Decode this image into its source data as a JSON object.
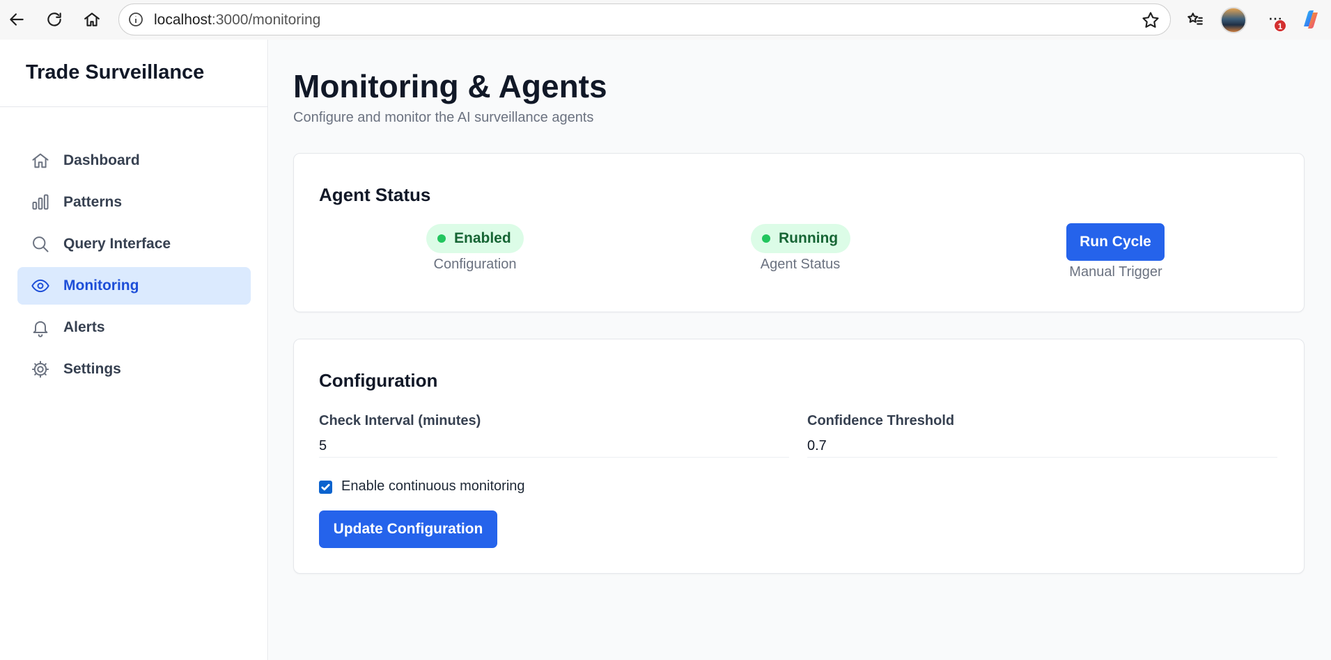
{
  "browser": {
    "url_host": "localhost",
    "url_path": ":3000/monitoring",
    "notification_count": "1"
  },
  "sidebar": {
    "brand": "Trade Surveillance",
    "items": [
      {
        "label": "Dashboard",
        "icon": "home-icon"
      },
      {
        "label": "Patterns",
        "icon": "bar-chart-icon"
      },
      {
        "label": "Query Interface",
        "icon": "search-icon"
      },
      {
        "label": "Monitoring",
        "icon": "eye-icon",
        "active": true
      },
      {
        "label": "Alerts",
        "icon": "bell-icon"
      },
      {
        "label": "Settings",
        "icon": "gear-icon"
      }
    ]
  },
  "page": {
    "title": "Monitoring & Agents",
    "subtitle": "Configure and monitor the AI surveillance agents"
  },
  "agent_status": {
    "heading": "Agent Status",
    "configuration_state": "Enabled",
    "configuration_caption": "Configuration",
    "agent_state": "Running",
    "agent_caption": "Agent Status",
    "run_button": "Run Cycle",
    "run_caption": "Manual Trigger"
  },
  "configuration": {
    "heading": "Configuration",
    "interval_label": "Check Interval (minutes)",
    "interval_value": "5",
    "threshold_label": "Confidence Threshold",
    "threshold_value": "0.7",
    "continuous_label": "Enable continuous monitoring",
    "continuous_checked": true,
    "update_button": "Update Configuration"
  },
  "colors": {
    "primary": "#2563eb",
    "active_bg": "#dbeafe",
    "status_bg": "#dcfce7",
    "status_dot": "#22c55e",
    "status_text": "#166534"
  }
}
